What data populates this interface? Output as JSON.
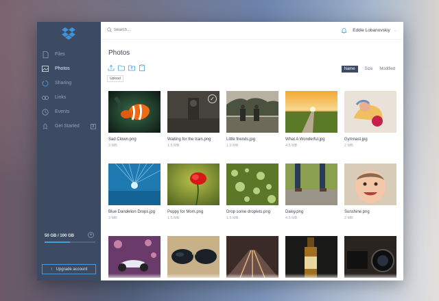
{
  "sidebar": {
    "items": [
      {
        "label": "Files",
        "icon": "file-icon"
      },
      {
        "label": "Photos",
        "icon": "photo-icon",
        "active": true
      },
      {
        "label": "Sharing",
        "icon": "sharing-icon"
      },
      {
        "label": "Links",
        "icon": "link-icon"
      },
      {
        "label": "Events",
        "icon": "events-icon"
      },
      {
        "label": "Get Started",
        "icon": "rocket-icon",
        "badge": "3"
      }
    ],
    "storage": {
      "text": "50 GB / 100 GB",
      "used_fraction": 0.5
    },
    "upgrade_label": "Upgrade account"
  },
  "topbar": {
    "search_placeholder": "Search...",
    "user_name": "Eddie Lobanovskiy"
  },
  "page_title": "Photos",
  "toolbar": {
    "tooltip": "Upload"
  },
  "sort": {
    "name": "Name",
    "size": "Size",
    "modified": "Modified"
  },
  "photos": [
    {
      "name": "Sad Clown.png",
      "size": "3 MB",
      "thumb": "clownfish"
    },
    {
      "name": "Waiting for the train.png",
      "size": "1.5 MB",
      "thumb": "dark",
      "selected": true
    },
    {
      "name": "Little friends.jpg",
      "size": "1.5 MB",
      "thumb": "friends"
    },
    {
      "name": "What A Wonderful.jpg",
      "size": "4.5 MB",
      "thumb": "sunset"
    },
    {
      "name": "Gymnast.jpg",
      "size": "2 MB",
      "thumb": "gymnast"
    },
    {
      "name": "Blue Dandelion Drops.jpg",
      "size": "3 MB",
      "thumb": "dandelion"
    },
    {
      "name": "Poppy for Mom.png",
      "size": "1.5 MB",
      "thumb": "poppy"
    },
    {
      "name": "Drop some droplets.png",
      "size": "1.5 MB",
      "thumb": "droplets"
    },
    {
      "name": "Daisy.png",
      "size": "4.5 MB",
      "thumb": "daisy"
    },
    {
      "name": "Sunshine.png",
      "size": "2 MB",
      "thumb": "baby"
    },
    {
      "name": "",
      "size": "",
      "thumb": "bike"
    },
    {
      "name": "",
      "size": "",
      "thumb": "sunglasses"
    },
    {
      "name": "",
      "size": "",
      "thumb": "road"
    },
    {
      "name": "",
      "size": "",
      "thumb": "bottle"
    },
    {
      "name": "",
      "size": "",
      "thumb": "camera"
    }
  ],
  "colors": {
    "sidebar": "#3d4a63",
    "accent": "#3fa2e0",
    "text": "#3b4352"
  }
}
